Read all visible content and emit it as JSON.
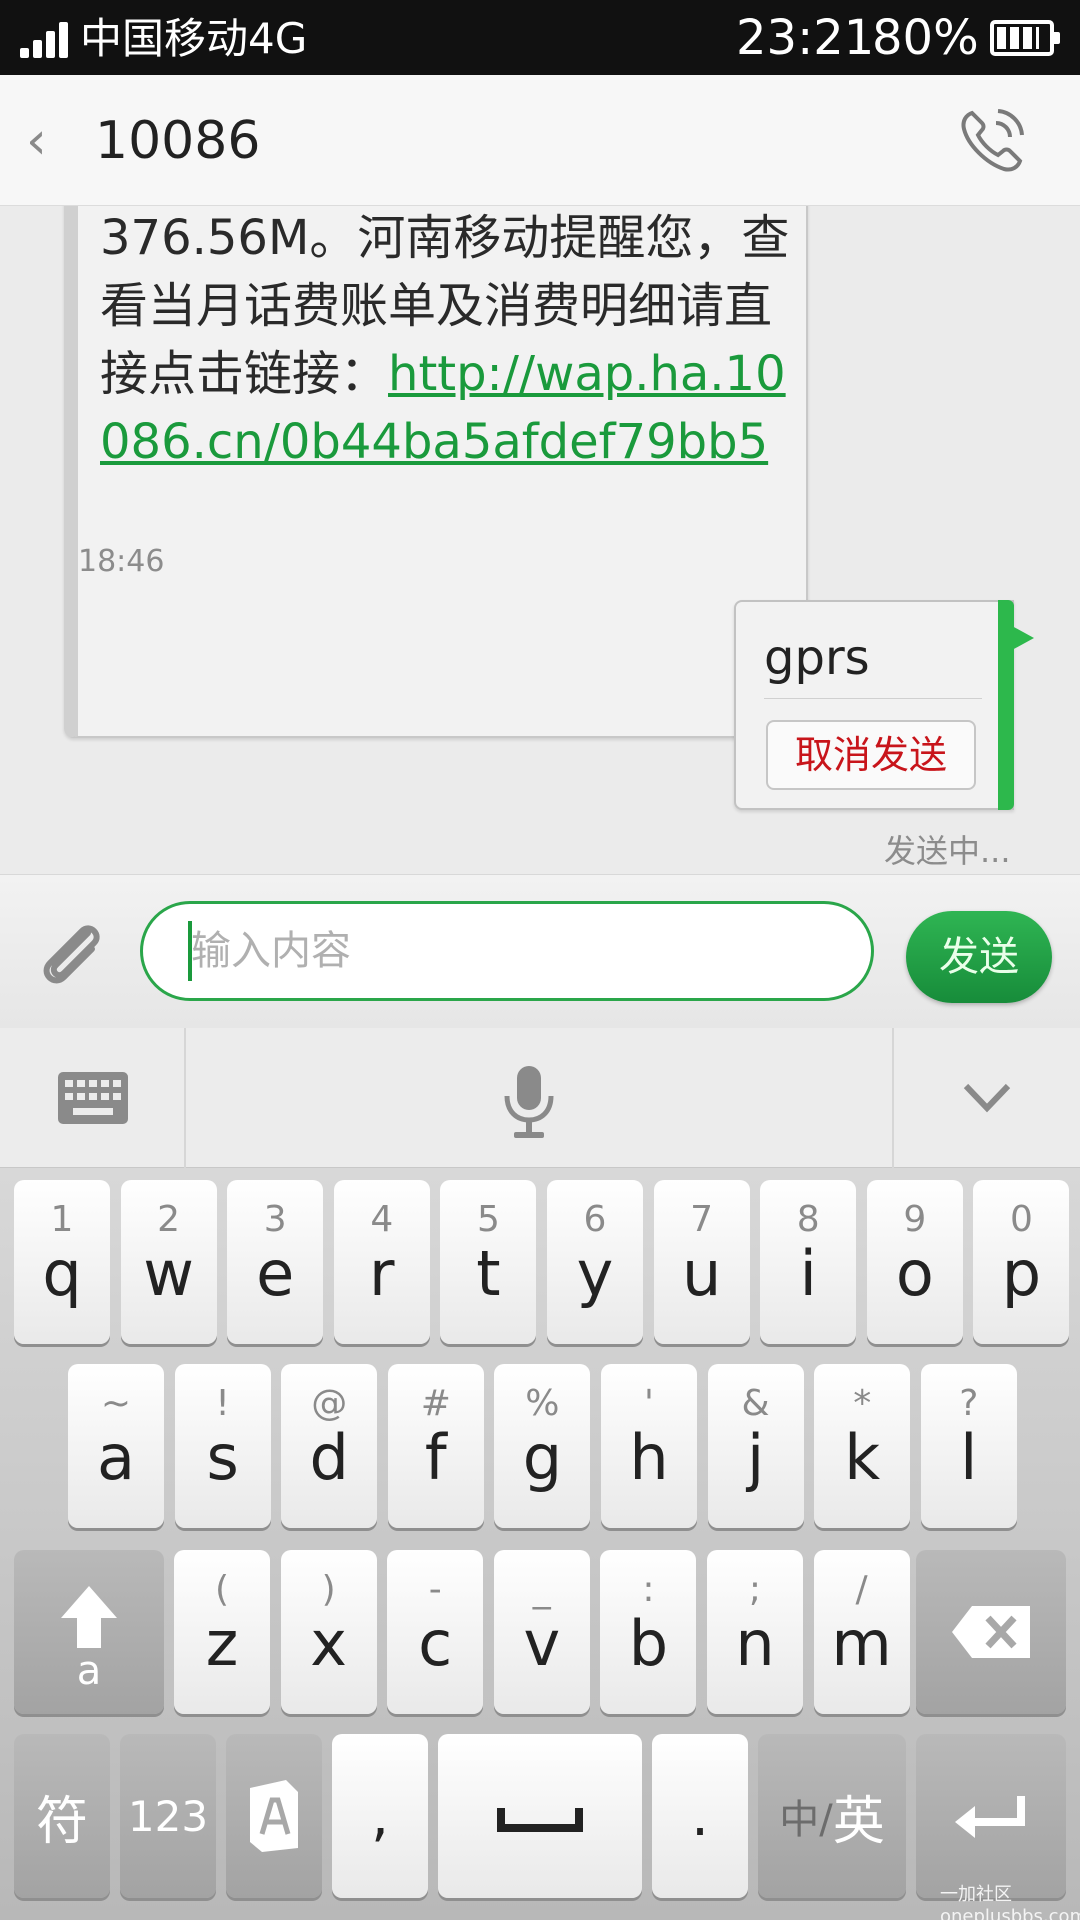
{
  "status_bar": {
    "carrier": "中国移动4G",
    "time": "23:21",
    "battery": "80%",
    "battery_level": 0.8
  },
  "header": {
    "title": "10086"
  },
  "conversation": {
    "incoming": {
      "text_lead": "376.56M。河南移动提醒您，查看当月话费账单及消费明细请直接点击链接：",
      "link": "http://wap.ha.10086.cn/0b44ba5afdef79bb5",
      "time": "18:46"
    },
    "outgoing": {
      "text": "gprs",
      "cancel_label": "取消发送",
      "status": "发送中..."
    }
  },
  "composer": {
    "placeholder": "输入内容",
    "send_label": "发送"
  },
  "keyboard": {
    "rows": [
      [
        {
          "h": "1",
          "k": "q"
        },
        {
          "h": "2",
          "k": "w"
        },
        {
          "h": "3",
          "k": "e"
        },
        {
          "h": "4",
          "k": "r"
        },
        {
          "h": "5",
          "k": "t"
        },
        {
          "h": "6",
          "k": "y"
        },
        {
          "h": "7",
          "k": "u"
        },
        {
          "h": "8",
          "k": "i"
        },
        {
          "h": "9",
          "k": "o"
        },
        {
          "h": "0",
          "k": "p"
        }
      ],
      [
        {
          "h": "~",
          "k": "a"
        },
        {
          "h": "!",
          "k": "s"
        },
        {
          "h": "@",
          "k": "d"
        },
        {
          "h": "#",
          "k": "f"
        },
        {
          "h": "%",
          "k": "g"
        },
        {
          "h": "'",
          "k": "h"
        },
        {
          "h": "&",
          "k": "j"
        },
        {
          "h": "*",
          "k": "k"
        },
        {
          "h": "?",
          "k": "l"
        }
      ],
      [
        {
          "h": "(",
          "k": "z"
        },
        {
          "h": ")",
          "k": "x"
        },
        {
          "h": "-",
          "k": "c"
        },
        {
          "h": "_",
          "k": "v"
        },
        {
          "h": ":",
          "k": "b"
        },
        {
          "h": ";",
          "k": "n"
        },
        {
          "h": "/",
          "k": "m"
        }
      ]
    ],
    "shift_sub": "a",
    "symbol_label": "符",
    "num_label": "123",
    "comma_label": ",",
    "period_label": ".",
    "lang_prefix": "中/",
    "lang_main": "英"
  },
  "watermark": "一加社区 oneplusbbs.com"
}
